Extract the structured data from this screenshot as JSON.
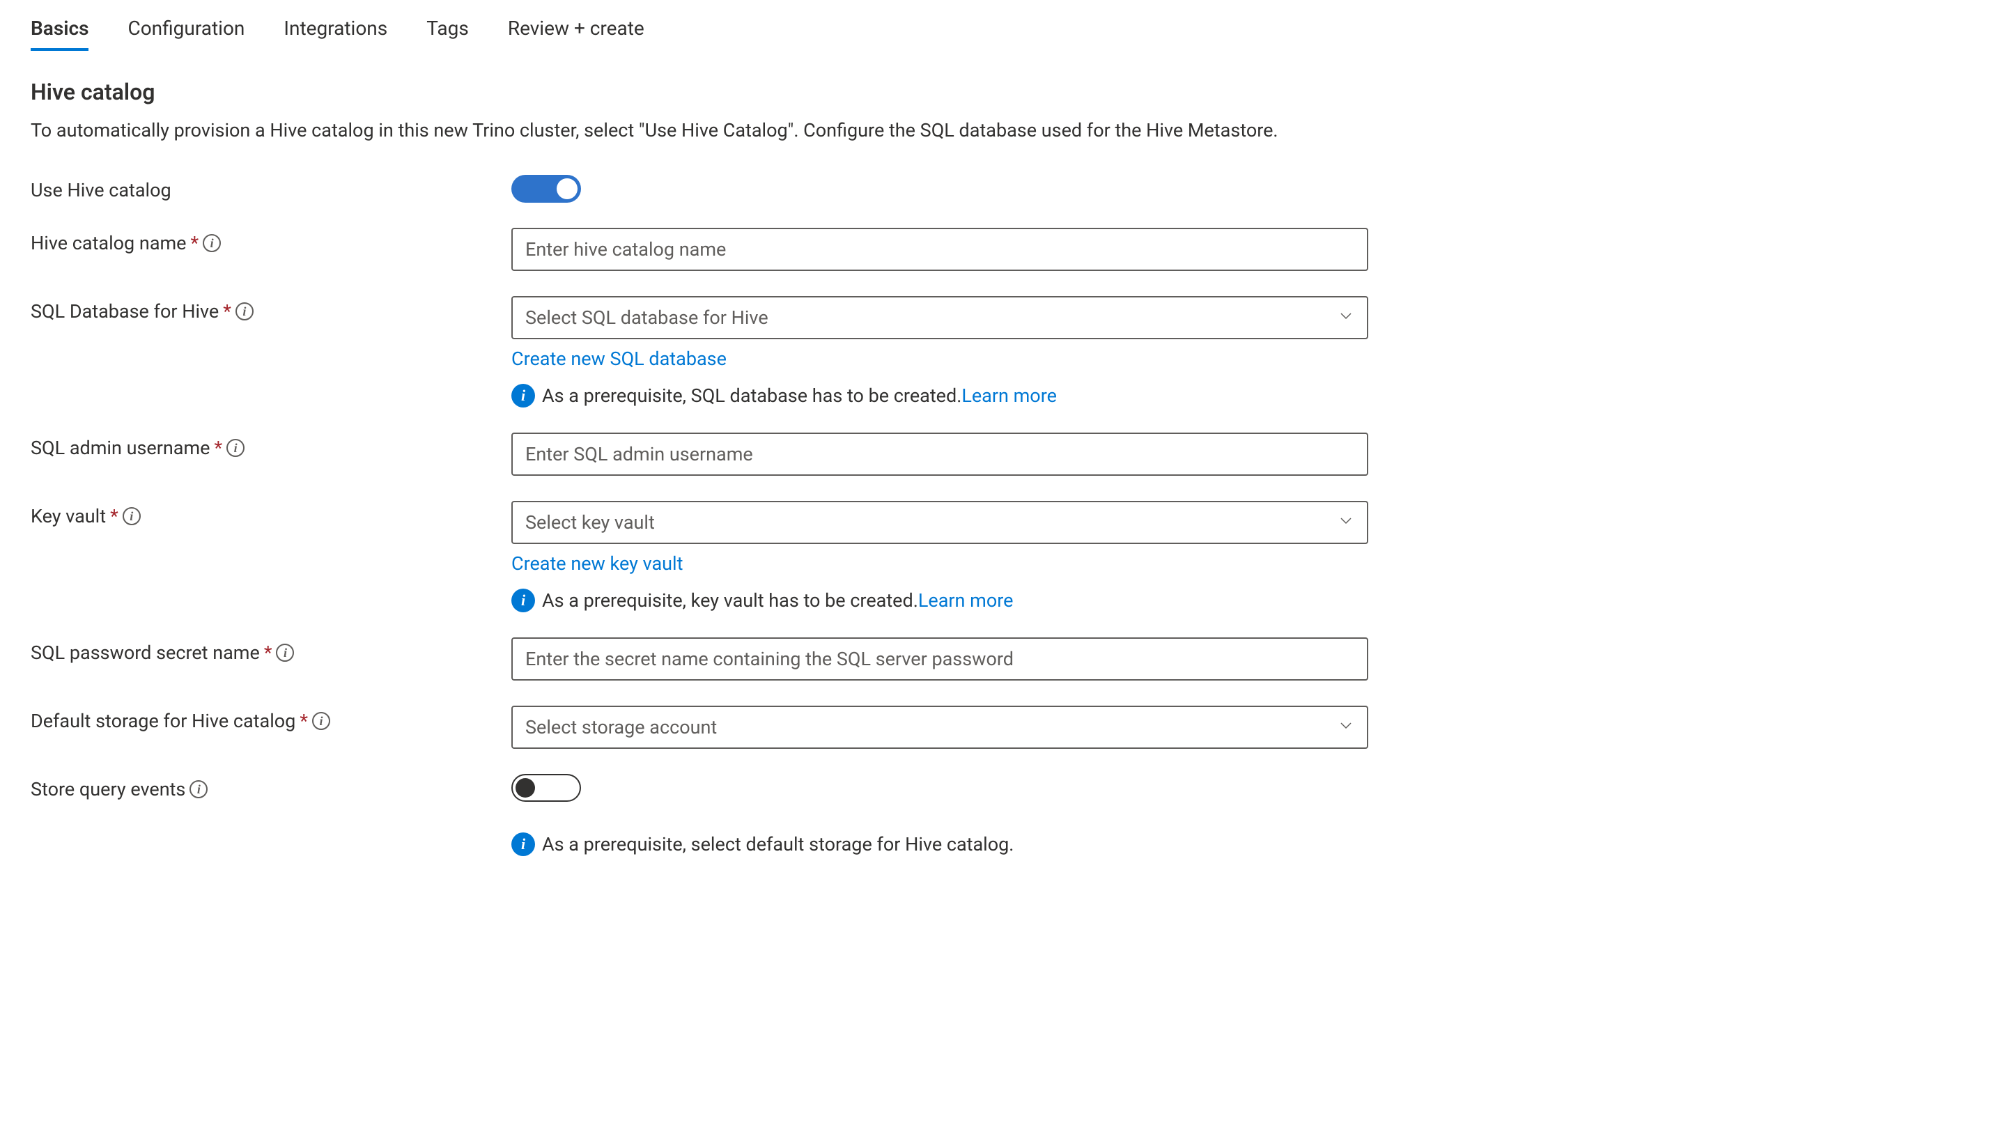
{
  "tabs": [
    {
      "label": "Basics",
      "active": true
    },
    {
      "label": "Configuration",
      "active": false
    },
    {
      "label": "Integrations",
      "active": false
    },
    {
      "label": "Tags",
      "active": false
    },
    {
      "label": "Review + create",
      "active": false
    }
  ],
  "section": {
    "title": "Hive catalog",
    "description": "To automatically provision a Hive catalog in this new Trino cluster, select \"Use Hive Catalog\". Configure the SQL database used for the Hive Metastore."
  },
  "fields": {
    "useHiveCatalog": {
      "label": "Use Hive catalog",
      "value": true
    },
    "hiveCatalogName": {
      "label": "Hive catalog name",
      "placeholder": "Enter hive catalog name",
      "required": true
    },
    "sqlDatabase": {
      "label": "SQL Database for Hive",
      "placeholder": "Select SQL database for Hive",
      "required": true,
      "createNewLabel": "Create new SQL database",
      "prereqText": "As a prerequisite, SQL database has to be created.",
      "learnMore": "Learn more"
    },
    "sqlAdminUsername": {
      "label": "SQL admin username",
      "placeholder": "Enter SQL admin username",
      "required": true
    },
    "keyVault": {
      "label": "Key vault",
      "placeholder": "Select key vault",
      "required": true,
      "createNewLabel": "Create new key vault",
      "prereqText": "As a prerequisite, key vault has to be created.",
      "learnMore": "Learn more"
    },
    "sqlPasswordSecret": {
      "label": "SQL password secret name",
      "placeholder": "Enter the secret name containing the SQL server password",
      "required": true
    },
    "defaultStorage": {
      "label": "Default storage for Hive catalog",
      "placeholder": "Select storage account",
      "required": true
    },
    "storeQueryEvents": {
      "label": "Store query events",
      "value": false,
      "prereqText": "As a prerequisite, select default storage for Hive catalog."
    }
  }
}
